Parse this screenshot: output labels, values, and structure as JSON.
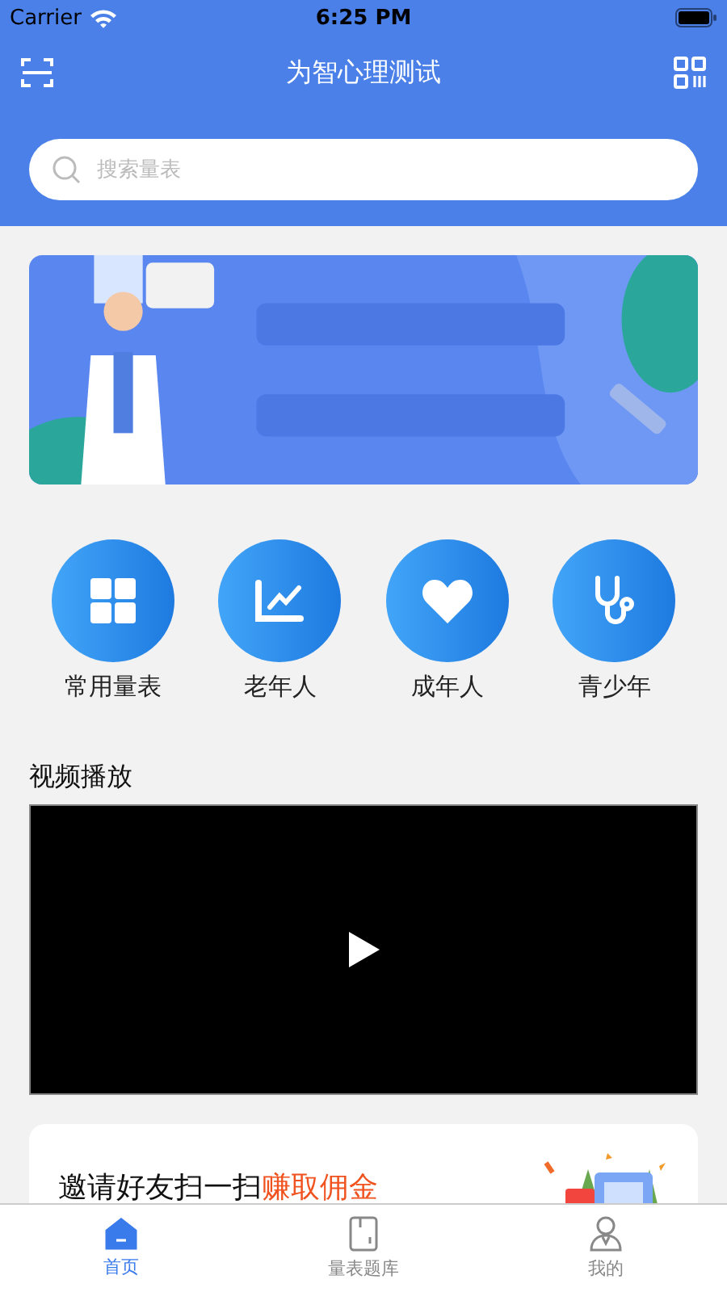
{
  "status_bar": {
    "carrier": "Carrier",
    "time": "6:25 PM"
  },
  "nav": {
    "title": "为智心理测试"
  },
  "search": {
    "placeholder": "搜索量表"
  },
  "categories": [
    {
      "label": "常用量表",
      "kind": "grid"
    },
    {
      "label": "老年人",
      "kind": "chart"
    },
    {
      "label": "成年人",
      "kind": "heart"
    },
    {
      "label": "青少年",
      "kind": "stethoscope"
    }
  ],
  "video": {
    "title": "视频播放"
  },
  "invite": {
    "text": "邀请好友扫一扫",
    "highlight": "赚取佣金"
  },
  "tabs": [
    {
      "label": "首页",
      "kind": "home",
      "selected": true
    },
    {
      "label": "量表题库",
      "kind": "book",
      "selected": false
    },
    {
      "label": "我的",
      "kind": "user",
      "selected": false
    }
  ]
}
